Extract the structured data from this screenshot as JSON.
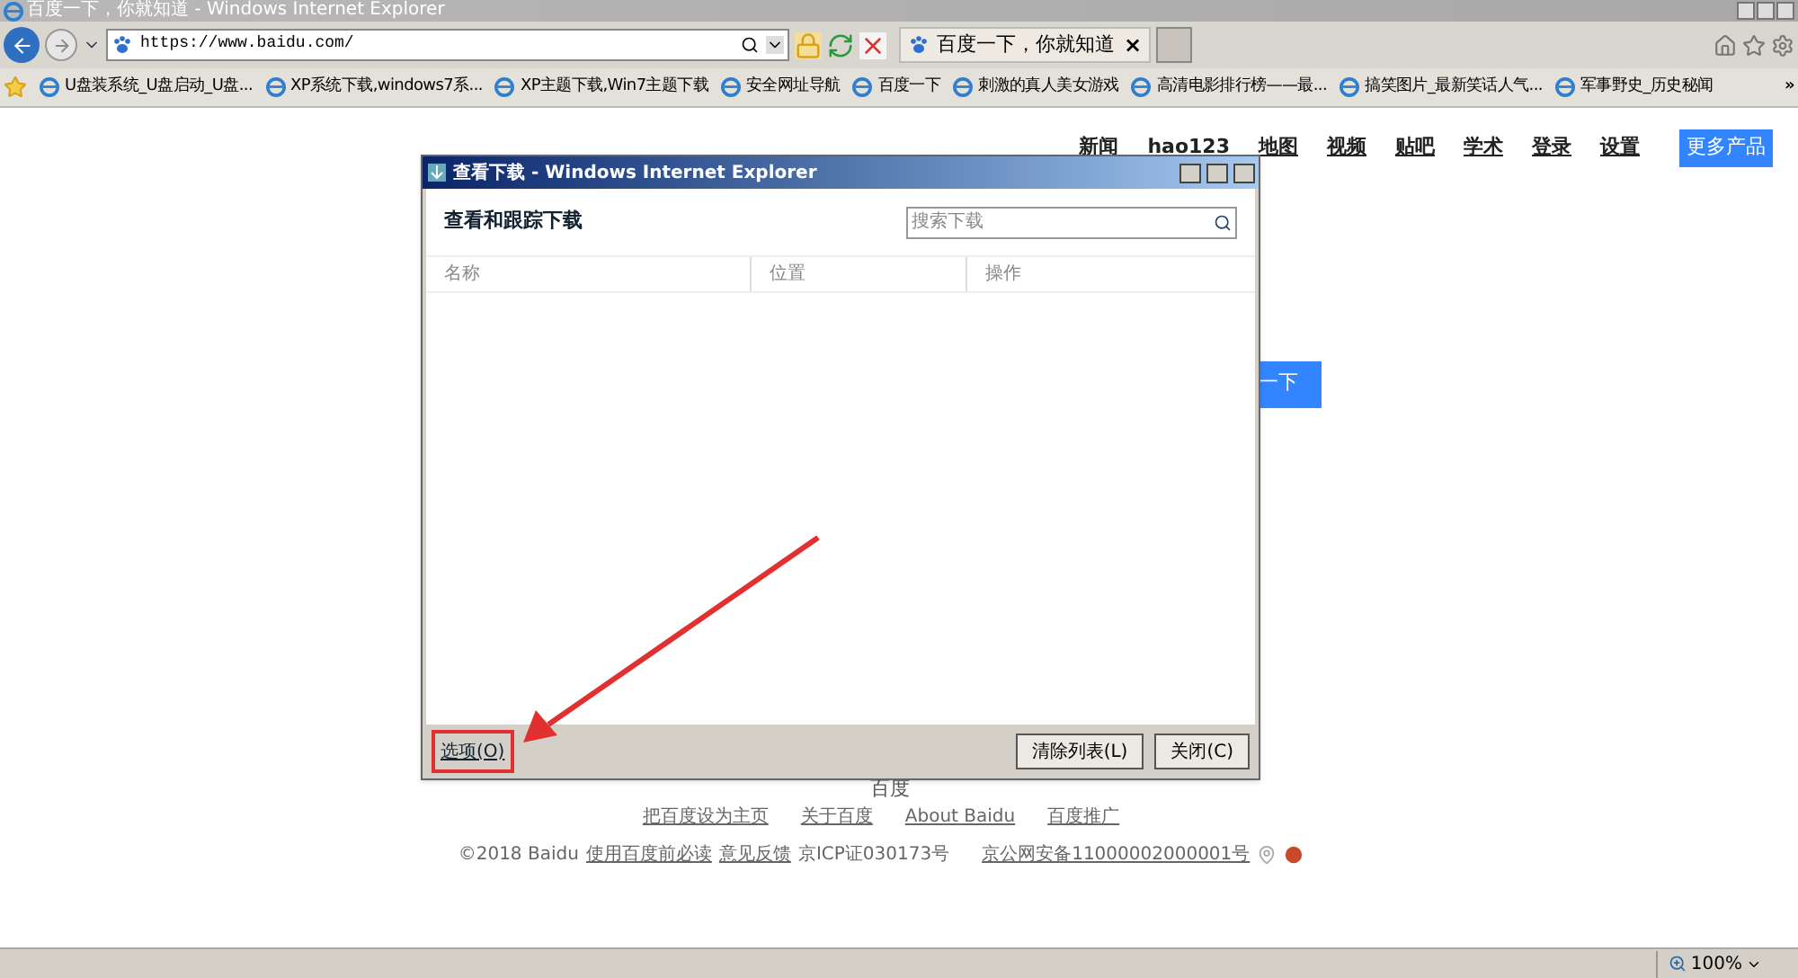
{
  "window": {
    "title": "百度一下，你就知道 - Windows Internet Explorer"
  },
  "toolbar": {
    "address": "https://www.baidu.com/"
  },
  "tab": {
    "title": "百度一下，你就知道",
    "close": "×"
  },
  "favorites": [
    "U盘装系统_U盘启动_U盘...",
    "XP系统下载,windows7系...",
    "XP主题下载,Win7主题下载",
    "安全网址导航",
    "百度一下",
    "刺激的真人美女游戏",
    "高清电影排行榜——最...",
    "搞笑图片_最新笑话人气...",
    "军事野史_历史秘闻"
  ],
  "favorites_more": "»",
  "page": {
    "nav": [
      {
        "label": "新闻",
        "kind": "link"
      },
      {
        "label": "hao123",
        "kind": "link"
      },
      {
        "label": "地图",
        "kind": "link"
      },
      {
        "label": "视频",
        "kind": "link"
      },
      {
        "label": "贴吧",
        "kind": "link"
      },
      {
        "label": "学术",
        "kind": "link"
      },
      {
        "label": "登录",
        "kind": "link"
      },
      {
        "label": "设置",
        "kind": "link"
      },
      {
        "label": "更多产品",
        "kind": "button"
      }
    ],
    "search_button": "一下",
    "partial_text": "百度",
    "footer_links": [
      "把百度设为主页",
      "关于百度",
      "About Baidu",
      "百度推广"
    ],
    "footer_line": [
      {
        "text": "©2018 Baidu",
        "kind": "text"
      },
      {
        "text": "使用百度前必读",
        "kind": "link"
      },
      {
        "text": "意见反馈",
        "kind": "link"
      },
      {
        "text": "京ICP证030173号",
        "kind": "text"
      },
      {
        "text": "京公网安备11000002000001号",
        "kind": "link"
      }
    ]
  },
  "dialog": {
    "title": "查看下载 - Windows Internet Explorer",
    "heading": "查看和跟踪下载",
    "search": {
      "placeholder": "搜索下载"
    },
    "columns": [
      "名称",
      "位置",
      "操作"
    ],
    "options_button": "选项(O)",
    "buttons": [
      "清除列表(L)",
      "关闭(C)"
    ]
  },
  "status_bar": {
    "zoom": "100%"
  }
}
